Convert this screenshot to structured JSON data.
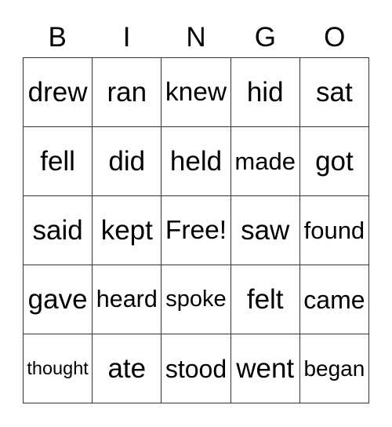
{
  "header": [
    "B",
    "I",
    "N",
    "G",
    "O"
  ],
  "cells": [
    [
      "drew",
      "ran",
      "knew",
      "hid",
      "sat"
    ],
    [
      "fell",
      "did",
      "held",
      "made",
      "got"
    ],
    [
      "said",
      "kept",
      "Free!",
      "saw",
      "found"
    ],
    [
      "gave",
      "heard",
      "spoke",
      "felt",
      "came"
    ],
    [
      "thought",
      "ate",
      "stood",
      "went",
      "began"
    ]
  ]
}
